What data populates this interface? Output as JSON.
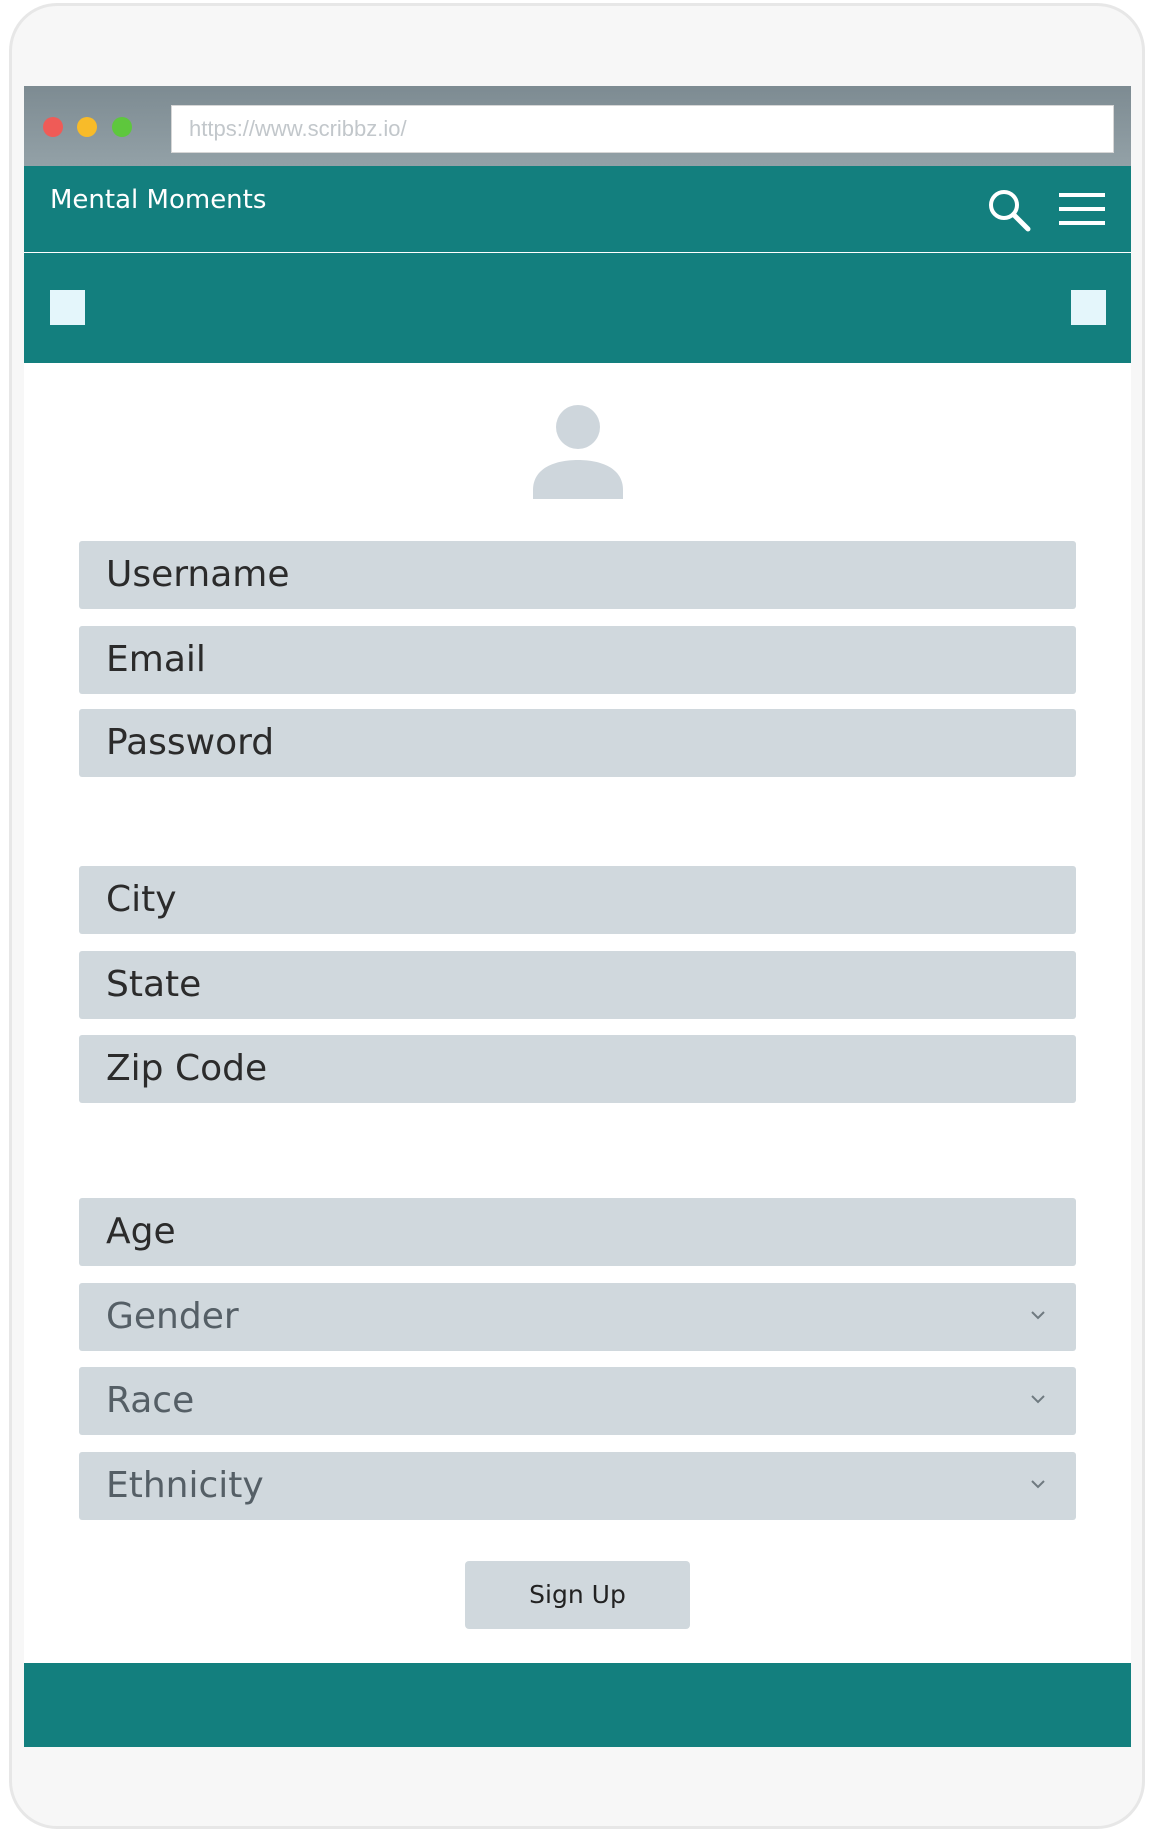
{
  "browser": {
    "url": "https://www.scribbz.io/"
  },
  "header": {
    "brand": "Mental Moments",
    "icons": [
      "search-icon",
      "hamburger-menu-icon"
    ]
  },
  "form": {
    "username_placeholder": "Username",
    "email_placeholder": "Email",
    "password_placeholder": "Password",
    "city_placeholder": "City",
    "state_placeholder": "State",
    "zip_placeholder": "Zip Code",
    "age_placeholder": "Age",
    "gender_label": "Gender",
    "race_label": "Race",
    "ethnicity_label": "Ethnicity",
    "submit_label": "Sign Up"
  },
  "colors": {
    "brand_teal": "#137f7e",
    "field_bg": "#d0d8dd",
    "placeholder_square": "#e4f6fb"
  }
}
